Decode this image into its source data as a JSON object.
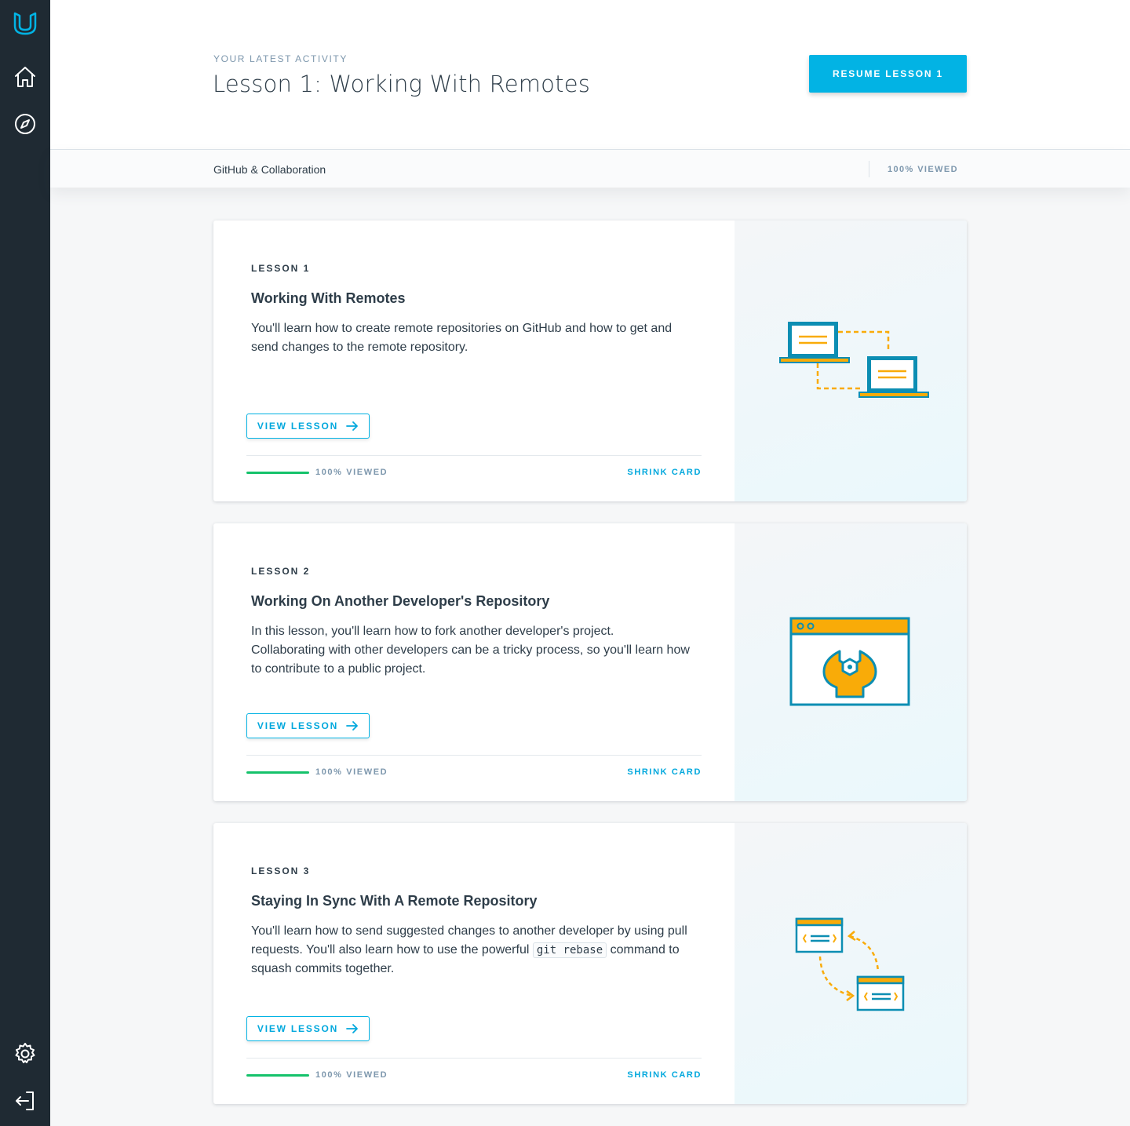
{
  "header": {
    "eyebrow": "YOUR LATEST ACTIVITY",
    "title": "Lesson 1: Working With Remotes",
    "resume_label": "RESUME LESSON 1"
  },
  "subbar": {
    "course": "GitHub & Collaboration",
    "progress": "100% VIEWED"
  },
  "lessons": [
    {
      "number": "LESSON 1",
      "title": "Working With Remotes",
      "description": "You'll learn how to create remote repositories on GitHub and how to get and send changes to the remote repository.",
      "view_label": "VIEW LESSON",
      "progress_fraction": 1.0,
      "progress_label": "100% VIEWED",
      "shrink_label": "SHRINK CARD",
      "illustration": "laptops-sync-icon"
    },
    {
      "number": "LESSON 2",
      "title": "Working On Another Developer's Repository",
      "description": "In this lesson, you'll learn how to fork another developer's project. Collaborating with other developers can be a tricky process, so you'll learn how to contribute to a public project.",
      "view_label": "VIEW LESSON",
      "progress_fraction": 1.0,
      "progress_label": "100% VIEWED",
      "shrink_label": "SHRINK CARD",
      "illustration": "browser-wrench-icon"
    },
    {
      "number": "LESSON 3",
      "title": "Staying In Sync With A Remote Repository",
      "description_pre": "You'll learn how to send suggested changes to another developer by using pull requests. You'll also learn how to use the powerful ",
      "description_code": "git rebase",
      "description_post": " command to squash commits together.",
      "view_label": "VIEW LESSON",
      "progress_fraction": 1.0,
      "progress_label": "100% VIEWED",
      "shrink_label": "SHRINK CARD",
      "illustration": "windows-exchange-icon"
    }
  ],
  "colors": {
    "sidebar": "#1f2a33",
    "accent": "#02b3e4",
    "progress": "#15c26b",
    "illustration_orange": "#f9ab08",
    "illustration_blue": "#0c8eb3"
  },
  "icons": {
    "logo": "udacity-logo-icon",
    "home": "home-icon",
    "explore": "compass-icon",
    "settings": "gear-icon",
    "logout": "logout-icon",
    "arrow": "arrow-right-icon"
  }
}
